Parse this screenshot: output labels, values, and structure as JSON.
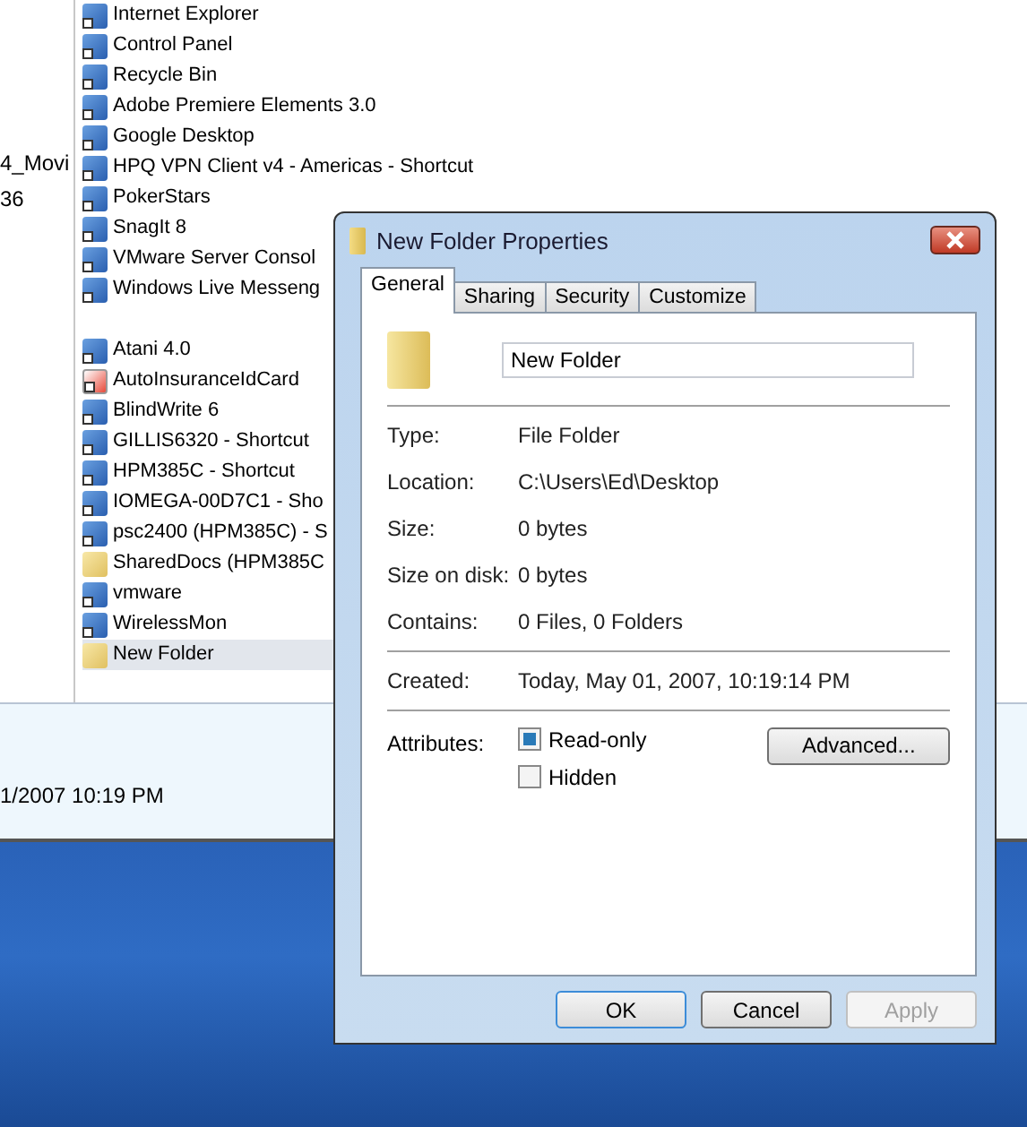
{
  "explorer": {
    "left_column": [
      "4_Movi",
      "36"
    ],
    "items_group_1": [
      {
        "label": "Internet Explorer",
        "kind": "app",
        "selected": false
      },
      {
        "label": "Control Panel",
        "kind": "app",
        "selected": false
      },
      {
        "label": "Recycle Bin",
        "kind": "app",
        "selected": false
      },
      {
        "label": "Adobe Premiere Elements 3.0",
        "kind": "app",
        "selected": false
      },
      {
        "label": "Google Desktop",
        "kind": "app",
        "selected": false
      },
      {
        "label": "HPQ VPN Client v4 - Americas - Shortcut",
        "kind": "app",
        "selected": false
      },
      {
        "label": "PokerStars",
        "kind": "app",
        "selected": false
      },
      {
        "label": "SnagIt 8",
        "kind": "app",
        "selected": false
      },
      {
        "label": "VMware Server Consol",
        "kind": "app",
        "selected": false
      },
      {
        "label": "Windows Live Messeng",
        "kind": "app",
        "selected": false
      }
    ],
    "items_group_2": [
      {
        "label": "Atani 4.0",
        "kind": "app",
        "selected": false
      },
      {
        "label": "AutoInsuranceIdCard",
        "kind": "document",
        "selected": false
      },
      {
        "label": "BlindWrite 6",
        "kind": "app",
        "selected": false
      },
      {
        "label": "GILLIS6320 - Shortcut",
        "kind": "app",
        "selected": false
      },
      {
        "label": "HPM385C - Shortcut",
        "kind": "app",
        "selected": false
      },
      {
        "label": "IOMEGA-00D7C1 - Sho",
        "kind": "app",
        "selected": false
      },
      {
        "label": "psc2400 (HPM385C) - S",
        "kind": "app",
        "selected": false
      },
      {
        "label": "SharedDocs (HPM385C",
        "kind": "folder",
        "selected": false
      },
      {
        "label": "vmware",
        "kind": "app",
        "selected": false
      },
      {
        "label": "WirelessMon",
        "kind": "app",
        "selected": false
      },
      {
        "label": "New Folder",
        "kind": "folder",
        "selected": true
      }
    ],
    "details_text": "1/2007 10:19 PM"
  },
  "dialog": {
    "title": "New Folder Properties",
    "tabs": [
      {
        "label": "General",
        "selected": true
      },
      {
        "label": "Sharing",
        "selected": false
      },
      {
        "label": "Security",
        "selected": false
      },
      {
        "label": "Customize",
        "selected": false
      }
    ],
    "name_field": {
      "value": "New Folder"
    },
    "properties": [
      {
        "label": "Type:",
        "value": "File Folder"
      },
      {
        "label": "Location:",
        "value": "C:\\Users\\Ed\\Desktop"
      },
      {
        "label": "Size:",
        "value": "0 bytes"
      },
      {
        "label": "Size on disk:",
        "value": "0 bytes"
      },
      {
        "label": "Contains:",
        "value": "0 Files, 0 Folders"
      }
    ],
    "created": {
      "label": "Created:",
      "value": "Today, May 01, 2007, 10:19:14 PM"
    },
    "attributes_label": "Attributes:",
    "attributes": [
      {
        "label": "Read-only",
        "checked": true
      },
      {
        "label": "Hidden",
        "checked": false
      }
    ],
    "advanced_button": "Advanced...",
    "buttons": [
      {
        "label": "OK",
        "default": true,
        "disabled": false
      },
      {
        "label": "Cancel",
        "default": false,
        "disabled": false
      },
      {
        "label": "Apply",
        "default": false,
        "disabled": true
      }
    ]
  }
}
